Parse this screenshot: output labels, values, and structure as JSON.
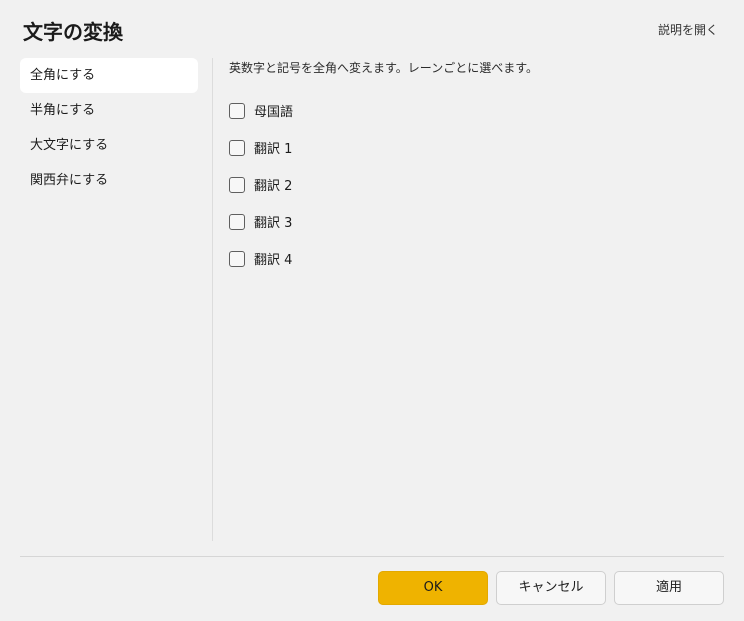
{
  "dialog": {
    "title": "文字の変換",
    "help_link": "説明を開く"
  },
  "sidebar": {
    "items": [
      {
        "label": "全角にする",
        "selected": true
      },
      {
        "label": "半角にする",
        "selected": false
      },
      {
        "label": "大文字にする",
        "selected": false
      },
      {
        "label": "関西弁にする",
        "selected": false
      }
    ]
  },
  "main": {
    "description": "英数字と記号を全角へ変えます。レーンごとに選べます。",
    "options": [
      {
        "label": "母国語",
        "checked": false
      },
      {
        "label": "翻訳 1",
        "checked": false
      },
      {
        "label": "翻訳 2",
        "checked": false
      },
      {
        "label": "翻訳 3",
        "checked": false
      },
      {
        "label": "翻訳 4",
        "checked": false
      }
    ]
  },
  "footer": {
    "ok_label": "OK",
    "cancel_label": "キャンセル",
    "apply_label": "適用"
  },
  "colors": {
    "background": "#f1f1f1",
    "accent": "#efb300",
    "selected_item": "#ffffff"
  }
}
